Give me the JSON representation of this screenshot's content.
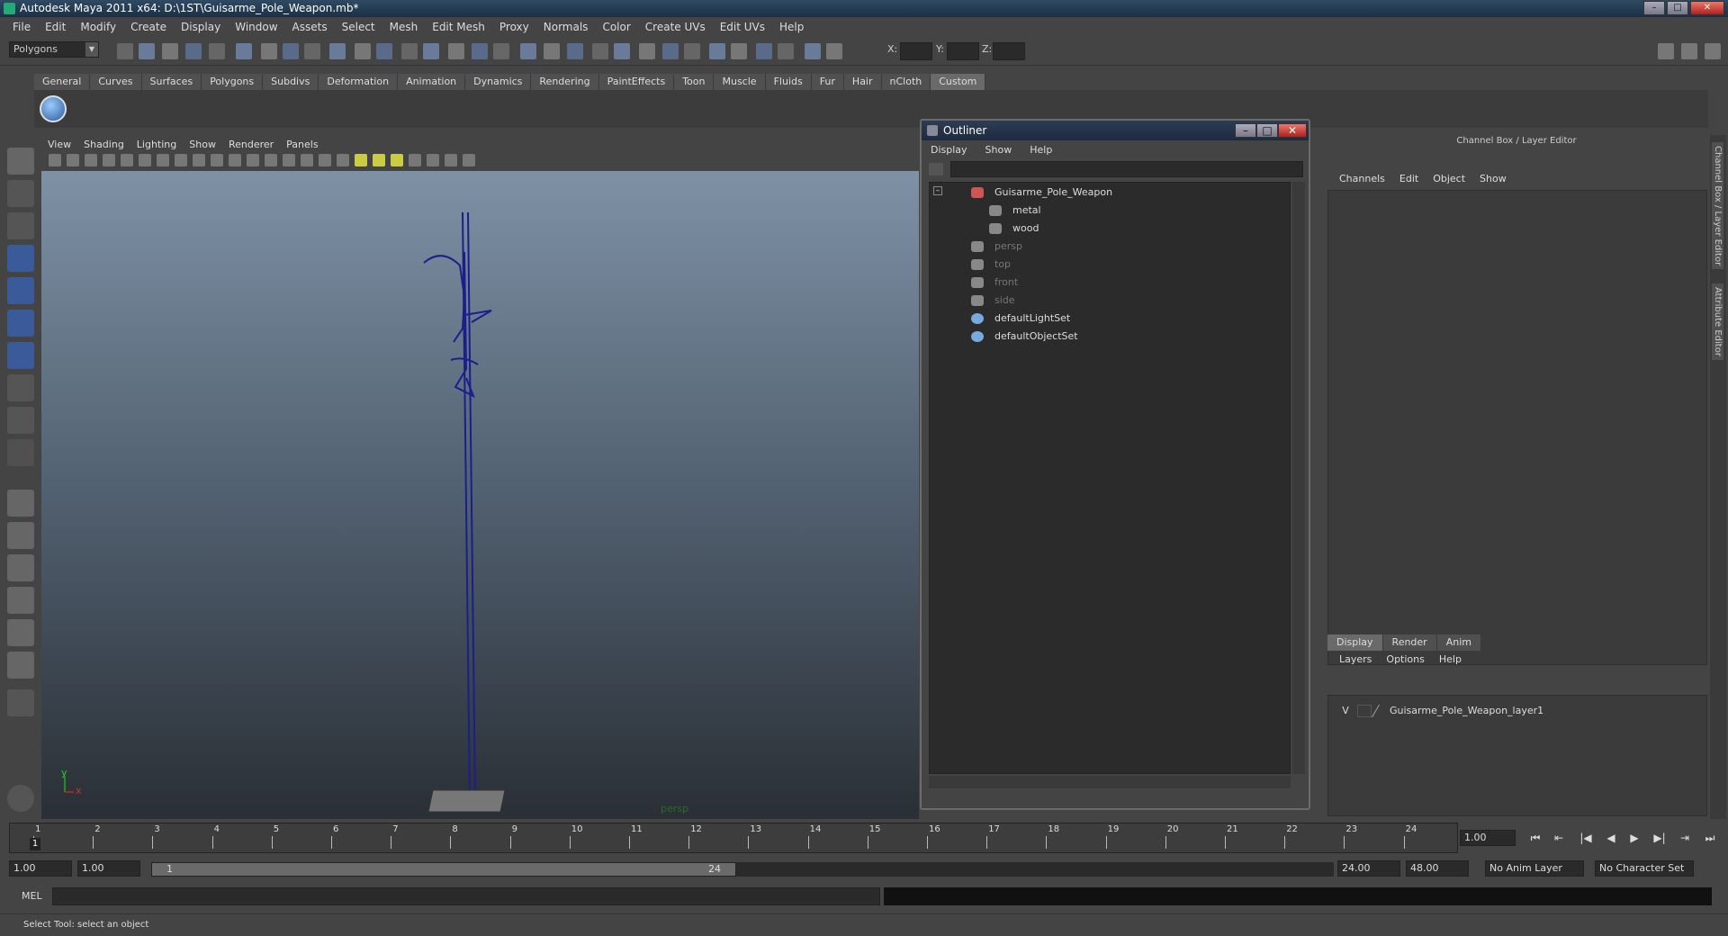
{
  "window": {
    "title": "Autodesk Maya 2011 x64: D:\\1ST\\Guisarme_Pole_Weapon.mb*"
  },
  "menubar": [
    "File",
    "Edit",
    "Modify",
    "Create",
    "Display",
    "Window",
    "Assets",
    "Select",
    "Mesh",
    "Edit Mesh",
    "Proxy",
    "Normals",
    "Color",
    "Create UVs",
    "Edit UVs",
    "Help"
  ],
  "statusline": {
    "mode": "Polygons",
    "x_label": "X:",
    "y_label": "Y:",
    "z_label": "Z:"
  },
  "shelf": {
    "tabs": [
      "General",
      "Curves",
      "Surfaces",
      "Polygons",
      "Subdivs",
      "Deformation",
      "Animation",
      "Dynamics",
      "Rendering",
      "PaintEffects",
      "Toon",
      "Muscle",
      "Fluids",
      "Fur",
      "Hair",
      "nCloth",
      "Custom"
    ],
    "active": "Custom"
  },
  "viewport": {
    "menu": [
      "View",
      "Shading",
      "Lighting",
      "Show",
      "Renderer",
      "Panels"
    ],
    "camera_label": "persp",
    "axis_y": "y",
    "axis_x": "x"
  },
  "outliner": {
    "title": "Outliner",
    "menu": [
      "Display",
      "Show",
      "Help"
    ],
    "items": [
      {
        "label": "Guisarme_Pole_Weapon",
        "dim": false
      },
      {
        "label": "metal",
        "dim": false
      },
      {
        "label": "wood",
        "dim": false
      },
      {
        "label": "persp",
        "dim": true
      },
      {
        "label": "top",
        "dim": true
      },
      {
        "label": "front",
        "dim": true
      },
      {
        "label": "side",
        "dim": true
      },
      {
        "label": "defaultLightSet",
        "dim": false
      },
      {
        "label": "defaultObjectSet",
        "dim": false
      }
    ]
  },
  "channelbox": {
    "header": "Channel Box / Layer Editor",
    "menu": [
      "Channels",
      "Edit",
      "Object",
      "Show"
    ],
    "layer_tabs": [
      "Display",
      "Render",
      "Anim"
    ],
    "layer_menu": [
      "Layers",
      "Options",
      "Help"
    ],
    "layer": {
      "visibility": "V",
      "name": "Guisarme_Pole_Weapon_layer1"
    }
  },
  "side_tabs": [
    "Channel Box / Layer Editor",
    "Attribute Editor"
  ],
  "timeline": {
    "ticks": [
      "1",
      "2",
      "3",
      "4",
      "5",
      "6",
      "7",
      "8",
      "9",
      "10",
      "11",
      "12",
      "13",
      "14",
      "15",
      "16",
      "17",
      "18",
      "19",
      "20",
      "21",
      "22",
      "23",
      "24"
    ],
    "current_frame": "1.00",
    "current_marker": "1"
  },
  "range": {
    "start": "1.00",
    "inner_start": "1.00",
    "slider_start": "1",
    "slider_end": "24",
    "inner_end": "24.00",
    "end": "48.00",
    "anim_layer": "No Anim Layer",
    "char_set": "No Character Set"
  },
  "mel_label": "MEL",
  "help_line": "Select Tool: select an object"
}
